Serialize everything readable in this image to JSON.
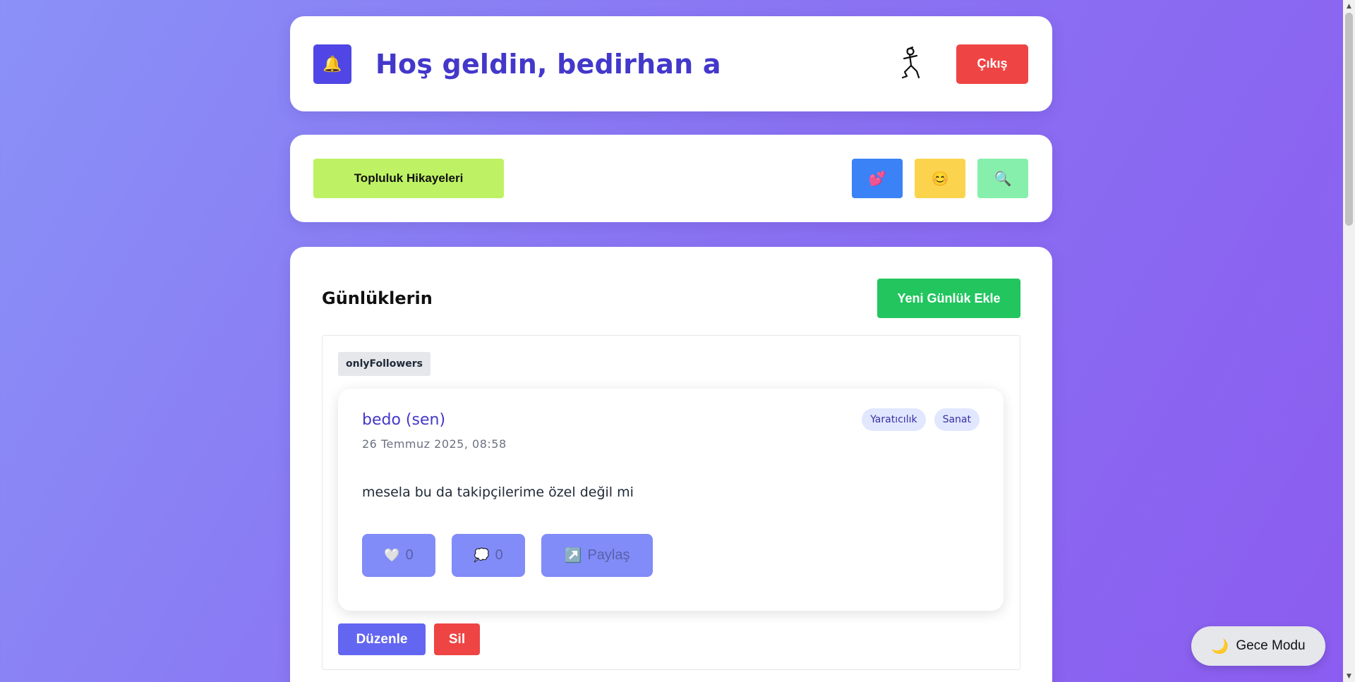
{
  "header": {
    "bell_icon": "🔔",
    "welcome": "Hoş geldin, bedirhan a",
    "logout_label": "Çıkış"
  },
  "toolbar": {
    "stories_label": "Topluluk Hikayeleri",
    "icon_buttons": [
      {
        "icon": "💕",
        "name": "hearts-icon",
        "color": "#3b82f6"
      },
      {
        "icon": "😊",
        "name": "smile-icon",
        "color": "#fcd34d"
      },
      {
        "icon": "🔍",
        "name": "search-icon",
        "color": "#86efac"
      }
    ]
  },
  "main": {
    "title": "Günlüklerin",
    "new_entry_label": "Yeni Günlük Ekle",
    "entry": {
      "privacy": "onlyFollowers",
      "author": "bedo (sen)",
      "date": "26 Temmuz 2025, 08:58",
      "tags": [
        "Yaratıcılık",
        "Sanat"
      ],
      "content": "mesela bu da takipçilerime özel değil mi",
      "like_icon": "🤍",
      "like_count": "0",
      "comment_icon": "💭",
      "comment_count": "0",
      "share_icon": "↗️",
      "share_label": "Paylaş",
      "edit_label": "Düzenle",
      "delete_label": "Sil"
    }
  },
  "night_mode": {
    "icon": "🌙",
    "label": "Gece Modu"
  }
}
